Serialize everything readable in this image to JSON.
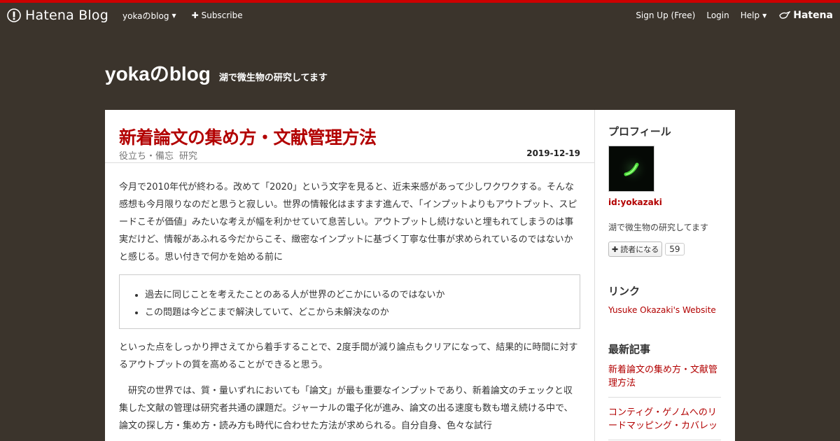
{
  "navbar": {
    "brand": "Hatena Blog",
    "blog_menu": "yokaのblog",
    "subscribe": "Subscribe",
    "signup": "Sign Up (Free)",
    "login": "Login",
    "help": "Help",
    "hatena": "Hatena"
  },
  "blog": {
    "title": "yokaのblog",
    "description": "湖で微生物の研究してます"
  },
  "entry": {
    "title": "新着論文の集め方・文献管理方法",
    "categories": [
      "役立ち・備忘",
      "研究"
    ],
    "date": "2019-12-19",
    "para1": "今月で2010年代が終わる。改めて「2020」という文字を見ると、近未来感があって少しワクワクする。そんな感想も今月限りなのだと思うと寂しい。世界の情報化はますます進んで、「インプットよりもアウトプット、スピードこそが価値」みたいな考えが幅を利かせていて息苦しい。アウトプットし続けないと埋もれてしまうのは事実だけど、情報があふれる今だからこそ、緻密なインプットに基づく丁寧な仕事が求められているのではないかと感じる。思い付きで何かを始める前に",
    "list": [
      "過去に同じことを考えたことのある人が世界のどこかにいるのではないか",
      "この問題は今どこまで解決していて、どこから未解決なのか"
    ],
    "para2": "といった点をしっかり押さえてから着手することで、2度手間が減り論点もクリアになって、結果的に時間に対するアウトプットの質を高めることができると思う。",
    "para3": "研究の世界では、質・量いずれにおいても「論文」が最も重要なインプットであり、新着論文のチェックと収集した文献の管理は研究者共通の課題だ。ジャーナルの電子化が進み、論文の出る速度も数も増え続ける中で、論文の探し方・集め方・読み方も時代に合わせた方法が求められる。自分自身、色々な試行"
  },
  "sidebar": {
    "profile_title": "プロフィール",
    "profile_id": "id:yokazaki",
    "profile_desc": "湖で微生物の研究してます",
    "subscribe_label": "読者になる",
    "subscribe_count": "59",
    "links_title": "リンク",
    "links": [
      "Yusuke Okazaki's Website"
    ],
    "recent_title": "最新記事",
    "recent": [
      "新着論文の集め方・文献管理方法",
      "コンティグ・ゲノムへのリードマッピング・カバレッ"
    ]
  },
  "colors": {
    "background": "#3b342c",
    "accent": "#b20000",
    "topline": "#cc0000"
  }
}
